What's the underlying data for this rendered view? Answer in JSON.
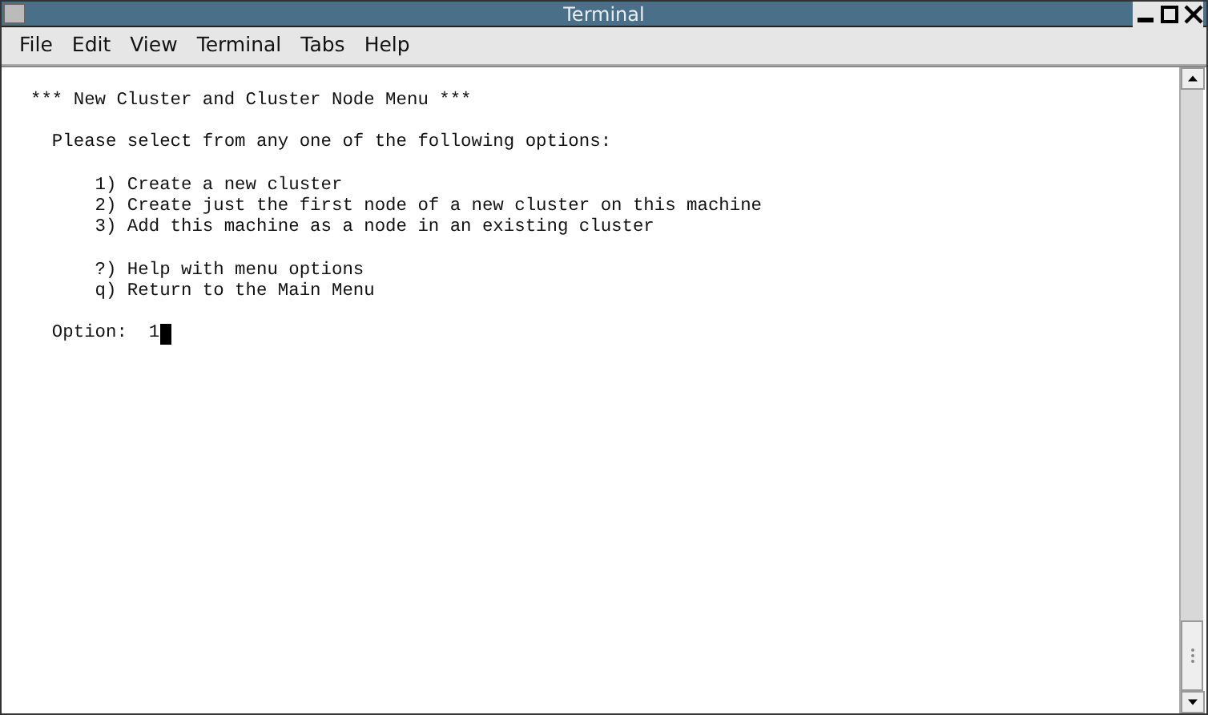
{
  "window": {
    "title": "Terminal"
  },
  "menu": [
    {
      "label": "File"
    },
    {
      "label": "Edit"
    },
    {
      "label": "View"
    },
    {
      "label": "Terminal"
    },
    {
      "label": "Tabs"
    },
    {
      "label": "Help"
    }
  ],
  "terminal": {
    "paragraphs": [
      [
        "*** New Cluster and Cluster Node Menu ***"
      ],
      [
        "  Please select from any one of the following options:"
      ],
      [
        "      1) Create a new cluster",
        "      2) Create just the first node of a new cluster on this machine",
        "      3) Add this machine as a node in an existing cluster"
      ],
      [
        "      ?) Help with menu options",
        "      q) Return to the Main Menu"
      ],
      [
        "  Option:  1"
      ]
    ],
    "cursor": true
  }
}
